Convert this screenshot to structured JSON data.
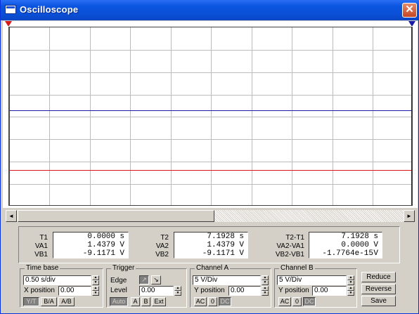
{
  "window": {
    "title": "Oscilloscope",
    "close_glyph": "✕"
  },
  "markers": {
    "cursor1": "1",
    "cursor2": "2"
  },
  "scrollbar": {
    "left_arrow": "◄",
    "right_arrow": "►"
  },
  "readouts": {
    "t1": {
      "labels": [
        "T1",
        "VA1",
        "VB1"
      ],
      "values": [
        "0.0000",
        "1.4379",
        "-9.1171"
      ],
      "units": [
        "s",
        "V",
        "V"
      ]
    },
    "t2": {
      "labels": [
        "T2",
        "VA2",
        "VB2"
      ],
      "values": [
        "7.1928",
        "1.4379",
        "-9.1171"
      ],
      "units": [
        "s",
        "V",
        "V"
      ]
    },
    "diff": {
      "labels": [
        "T2-T1",
        "VA2-VA1",
        "VB2-VB1"
      ],
      "values": [
        "7.1928",
        "0.0000",
        "-1.7764e-15"
      ],
      "units": [
        "s",
        "V",
        "V"
      ]
    }
  },
  "timebase": {
    "title": "Time base",
    "value": "0.50 s/div",
    "xpos_label": "X position",
    "xpos_value": "0.00",
    "buttons": [
      "Y/T",
      "B/A",
      "A/B"
    ]
  },
  "trigger": {
    "title": "Trigger",
    "edge_label": "Edge",
    "level_label": "Level",
    "level_value": "0.00",
    "rising_glyph": "↗",
    "falling_glyph": "↘",
    "buttons": [
      "Auto",
      "A",
      "B",
      "Ext"
    ]
  },
  "channel_a": {
    "title": "Channel A",
    "value": "5 V/Div",
    "ypos_label": "Y position",
    "ypos_value": "0.00",
    "buttons": [
      "AC",
      "0",
      "DC"
    ]
  },
  "channel_b": {
    "title": "Channel B",
    "value": "5 V/Div",
    "ypos_label": "Y position",
    "ypos_value": "0.00",
    "buttons": [
      "AC",
      "0",
      "DC"
    ]
  },
  "actions": {
    "reduce": "Reduce",
    "reverse": "Reverse",
    "save": "Save"
  },
  "colors": {
    "channel_a_trace": "#1a1aa8",
    "channel_b_trace": "#d81818",
    "titlebar": "#0a55e0"
  }
}
